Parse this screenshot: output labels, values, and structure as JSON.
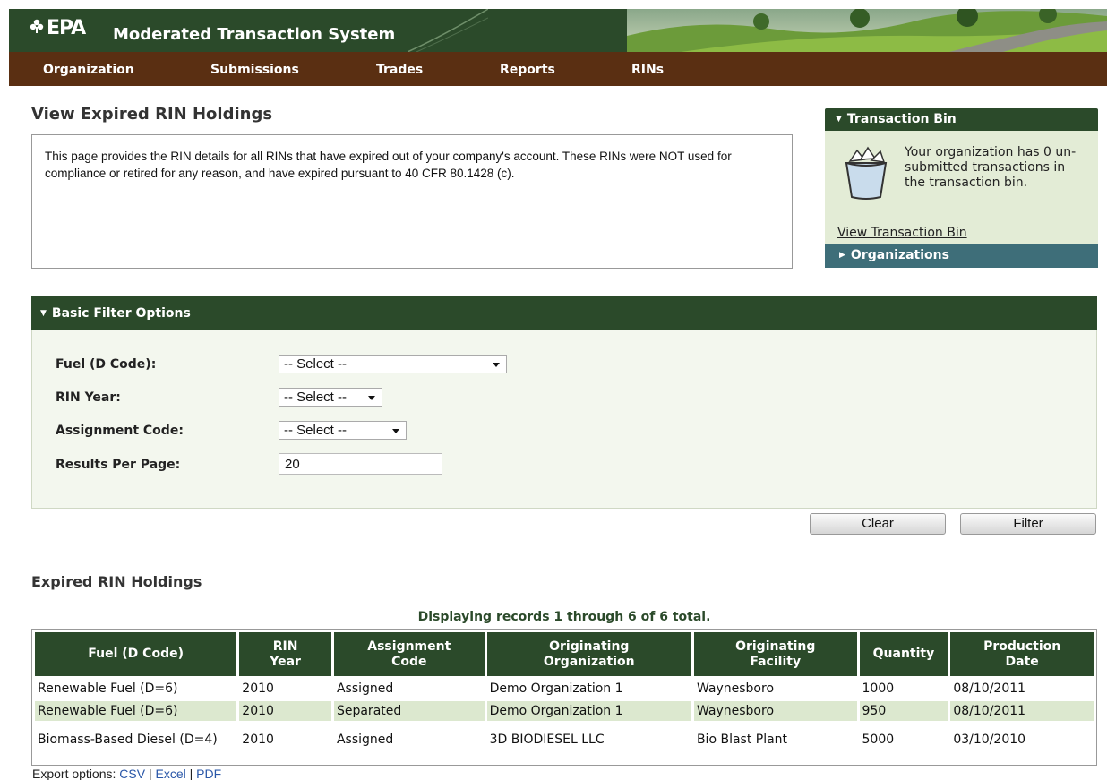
{
  "header": {
    "logo_text": "EPA",
    "app_title": "Moderated Transaction System"
  },
  "nav": {
    "items": [
      "Organization",
      "Submissions",
      "Trades",
      "Reports",
      "RINs"
    ]
  },
  "page_title": "View Expired RIN Holdings",
  "description": "This page provides the RIN details for all RINs that have expired out of your company's account.  These RINs were NOT used for compliance or retired for any reason, and have expired pursuant to 40 CFR 80.1428 (c).",
  "transaction_bin": {
    "header": "Transaction Bin",
    "message": "Your organization has 0 un-submitted transactions in the transaction bin.",
    "link": "View Transaction Bin"
  },
  "organizations_panel": {
    "header": "Organizations"
  },
  "filter": {
    "header": "Basic Filter Options",
    "fuel_label": "Fuel (D Code):",
    "fuel_value": "-- Select --",
    "year_label": "RIN Year:",
    "year_value": "-- Select --",
    "assign_label": "Assignment Code:",
    "assign_value": "-- Select --",
    "results_label": "Results Per Page:",
    "results_value": "20",
    "clear_label": "Clear",
    "filter_label": "Filter"
  },
  "results": {
    "title": "Expired RIN Holdings",
    "records_info": "Displaying records 1 through 6 of 6 total.",
    "headers": [
      [
        "Fuel (D Code)"
      ],
      [
        "RIN",
        "Year"
      ],
      [
        "Assignment",
        "Code"
      ],
      [
        "Originating",
        "Organization"
      ],
      [
        "Originating",
        "Facility"
      ],
      [
        "Quantity"
      ],
      [
        "Production",
        "Date"
      ]
    ],
    "rows": [
      [
        "Renewable Fuel (D=6)",
        "2010",
        "Assigned",
        "Demo Organization 1",
        "Waynesboro",
        "1000",
        "08/10/2011"
      ],
      [
        "Renewable Fuel (D=6)",
        "2010",
        "Separated",
        "Demo Organization 1",
        "Waynesboro",
        "950",
        "08/10/2011"
      ],
      [
        "Biomass-Based Diesel (D=4)",
        "2010",
        "Assigned",
        "3D BIODIESEL LLC",
        "Bio Blast Plant",
        "5000",
        "03/10/2010"
      ]
    ]
  },
  "export": {
    "label": "Export options:",
    "csv": "CSV",
    "excel": "Excel",
    "pdf": "PDF",
    "separator": "|"
  }
}
